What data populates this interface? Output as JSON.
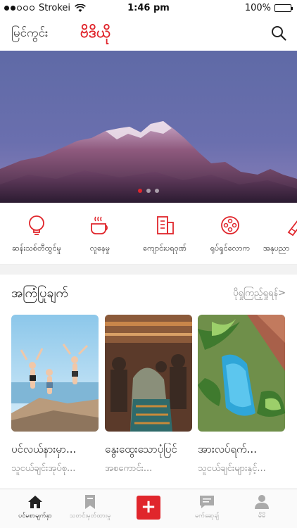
{
  "status_bar": {
    "carrier": "Strokei",
    "time": "1:46 pm",
    "battery": "100%"
  },
  "header": {
    "city": "မြင်ကွင်း",
    "brand": "ဗိဒိယို",
    "search_icon": "search-icon"
  },
  "banner": {
    "page_count": 3,
    "active_page": 1
  },
  "categories": [
    {
      "label": "ဆန်းသစ်တီထွင်မှု",
      "icon": "lightbulb-icon"
    },
    {
      "label": "လူနေမှု",
      "icon": "coffee-cup-icon"
    },
    {
      "label": "ကျောင်းပရဝုဏ်",
      "icon": "building-icon"
    },
    {
      "label": "ရုပ်ရှင်လောက",
      "icon": "film-reel-icon"
    },
    {
      "label": "အနုပညာ",
      "icon": "brush-icon"
    }
  ],
  "section": {
    "title": "အကြံပြုချက်",
    "more": "ပိုရှုကြည့်ရှုရန်>"
  },
  "cards": [
    {
      "title": "ပင်လယ်နားမှာ...",
      "subtitle": "သူငယ်ချင်းအုပ်စု..."
    },
    {
      "title": "နွေးထွေးသောပုံပြင်",
      "subtitle": "အစကောင်း..."
    },
    {
      "title": "အားလပ်ရက်...",
      "subtitle": "သူငယ်ချင်းများနှင့်..."
    }
  ],
  "tabbar": {
    "items": [
      {
        "label": "ပင်မစာမျက်နှာ",
        "icon": "home-icon"
      },
      {
        "label": "သတင်းမှတ်ထားမှု",
        "icon": "bookmark-icon"
      },
      {
        "label": "",
        "icon": "plus-icon"
      },
      {
        "label": "မက်ဆေ့ချ်",
        "icon": "message-icon"
      },
      {
        "label": "မိမိ",
        "icon": "user-icon"
      }
    ],
    "add_label": "+"
  },
  "colors": {
    "accent": "#e0262c",
    "muted": "#888888"
  }
}
